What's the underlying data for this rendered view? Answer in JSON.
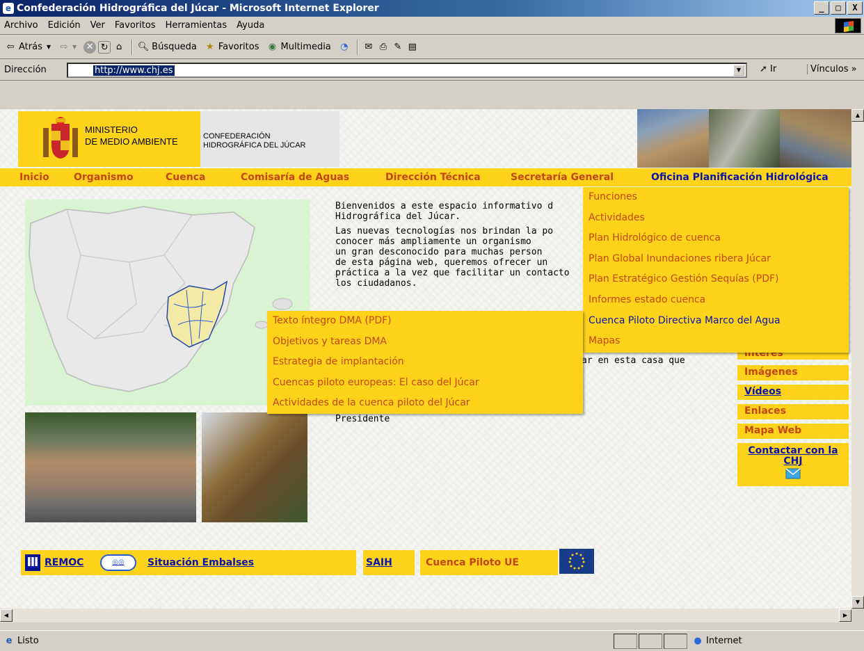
{
  "window": {
    "title": "Confederación Hidrográfica del Júcar - Microsoft Internet Explorer",
    "buttons": [
      "_",
      "□",
      "X"
    ]
  },
  "menu": [
    "Archivo",
    "Edición",
    "Ver",
    "Favoritos",
    "Herramientas",
    "Ayuda"
  ],
  "toolbar": {
    "back": "Atrás",
    "search": "Búsqueda",
    "favorites": "Favoritos",
    "multimedia": "Multimedia"
  },
  "address": {
    "label": "Dirección",
    "url": "http://www.chj.es",
    "go": "Ir",
    "links": "Vínculos"
  },
  "header": {
    "ministerio": [
      "MINISTERIO",
      "DE MEDIO AMBIENTE"
    ],
    "confederacion": [
      "CONFEDERACIÓN",
      "HIDROGRÁFICA DEL JÚCAR"
    ]
  },
  "nav": [
    "Inicio",
    "Organismo",
    "Cuenca",
    "Comisaría de Aguas",
    "Dirección Técnica",
    "Secretaría General",
    "Oficina Planificación Hidrológica"
  ],
  "dropdown_main": [
    "Funciones",
    "Actividades",
    "Plan Hidrológico de cuenca",
    "Plan Global Inundaciones ribera Júcar",
    "Plan Estratégico Gestión Sequías (PDF)",
    "Informes estado cuenca",
    "Cuenca Piloto Directiva Marco del Agua",
    "Mapas"
  ],
  "dropdown_sub": [
    "Texto íntegro DMA (PDF)",
    "Objetivos y tareas DMA",
    "Estrategia de implantación",
    "Cuencas piloto europeas: El caso del Júcar",
    "Actividades de la cuenca piloto del Júcar"
  ],
  "welcome": {
    "p1": "Bienvenidos a este espacio informativo d\nHidrográfica del Júcar.",
    "p2": "Las nuevas tecnologías nos brindan la po\nconocer más ampliamente un organismo\nun gran desconocido para muchas person\nde esta página web, queremos ofrecer un\npráctica a la vez que facilitar un contacto\nlos ciudadanos.",
    "casa": "ar en esta casa que",
    "president": "Presidente"
  },
  "right_links": [
    "interés",
    "Imágenes",
    "Vídeos",
    "Enlaces",
    "Mapa Web",
    "Contactar con la CHJ"
  ],
  "bottom": {
    "remoc": "REMOC",
    "embalses": "Situación Embalses",
    "saih": "SAIH",
    "cuenca_piloto": "Cuenca Piloto UE"
  },
  "status": {
    "text": "Listo",
    "zone": "Internet"
  }
}
